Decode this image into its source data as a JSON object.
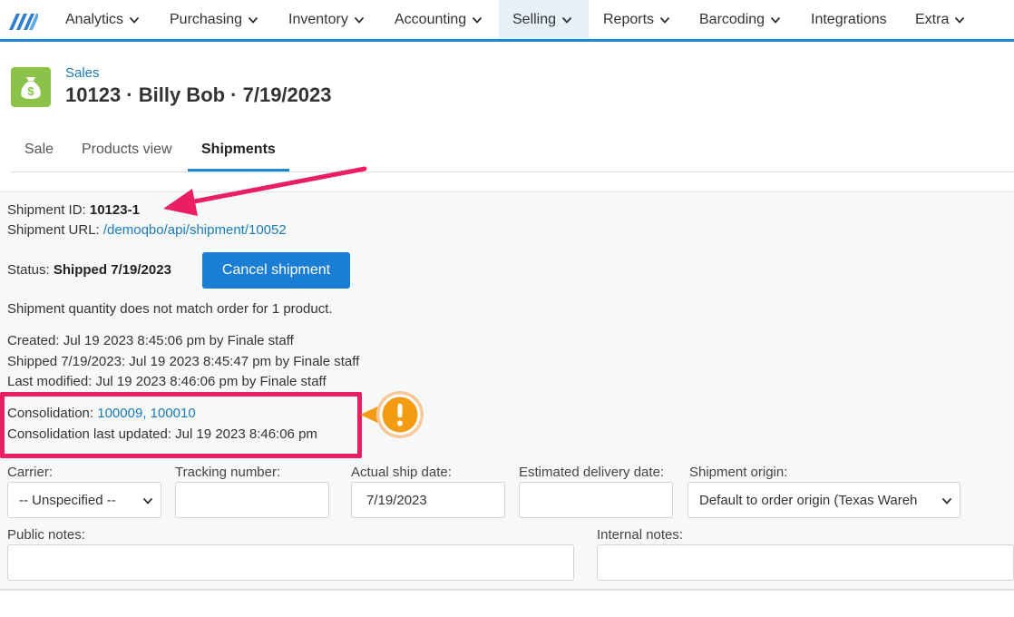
{
  "nav": {
    "items": [
      {
        "label": "Analytics"
      },
      {
        "label": "Purchasing"
      },
      {
        "label": "Inventory"
      },
      {
        "label": "Accounting"
      },
      {
        "label": "Selling"
      },
      {
        "label": "Reports"
      },
      {
        "label": "Barcoding"
      },
      {
        "label": "Integrations"
      },
      {
        "label": "Extra"
      }
    ]
  },
  "header": {
    "breadcrumb": "Sales",
    "title": "10123 · Billy Bob · 7/19/2023"
  },
  "tabs": [
    {
      "label": "Sale"
    },
    {
      "label": "Products view"
    },
    {
      "label": "Shipments"
    }
  ],
  "shipment": {
    "id_label": "Shipment ID: ",
    "id_value": "10123-1",
    "url_label": "Shipment URL: ",
    "url_value": "/demoqbo/api/shipment/10052",
    "status_label": "Status: ",
    "status_value": "Shipped 7/19/2023",
    "cancel_label": "Cancel shipment",
    "warning": "Shipment quantity does not match order for 1 product.",
    "created": "Created: Jul 19 2023 8:45:06 pm by Finale staff",
    "shipped": "Shipped 7/19/2023: Jul 19 2023 8:45:47 pm by Finale staff",
    "modified": "Last modified: Jul 19 2023 8:46:06 pm by Finale staff",
    "consolidation_label": "Consolidation: ",
    "consolidation_links": [
      "100009",
      "100010"
    ],
    "consolidation_sep": ", ",
    "consolidation_updated": "Consolidation last updated: Jul 19 2023 8:46:06 pm"
  },
  "form": {
    "carrier_label": "Carrier:",
    "carrier_value": "-- Unspecified --",
    "tracking_label": "Tracking number:",
    "tracking_value": "",
    "ship_date_label": "Actual ship date:",
    "ship_date_value": "7/19/2023",
    "delivery_label": "Estimated delivery date:",
    "delivery_value": "",
    "origin_label": "Shipment origin:",
    "origin_value": "Default to order origin (Texas Wareh",
    "public_notes_label": "Public notes:",
    "internal_notes_label": "Internal notes:"
  },
  "colors": {
    "accent": "#1a87d6",
    "link": "#1a7ab8",
    "highlight": "#e91e63",
    "badge": "#f39c12",
    "icon_bg": "#8bc34a"
  }
}
